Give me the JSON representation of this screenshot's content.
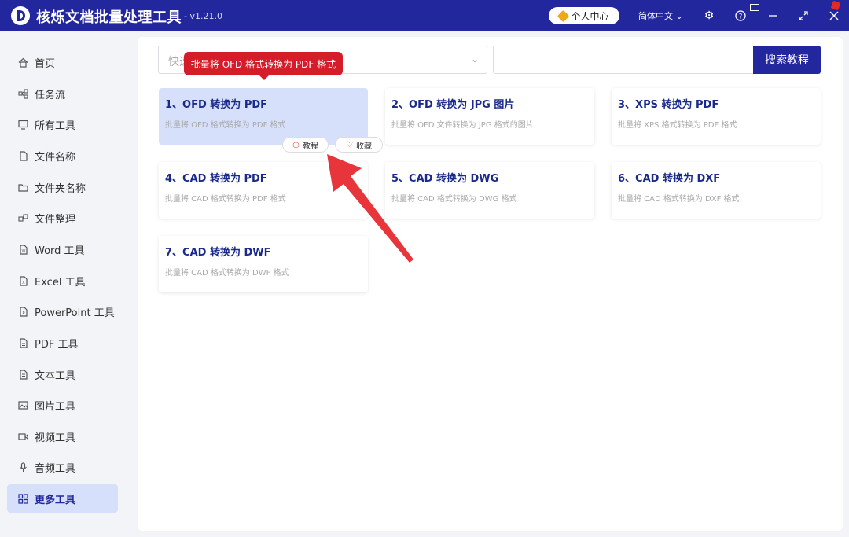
{
  "app": {
    "title": "核烁文档批量处理工具",
    "version": "- v1.21.0"
  },
  "titlebar": {
    "user_center": "个人中心",
    "language": "简体中文"
  },
  "sidebar": {
    "items": [
      {
        "label": "首页",
        "icon": "home-icon"
      },
      {
        "label": "任务流",
        "icon": "workflow-icon"
      },
      {
        "label": "所有工具",
        "icon": "monitor-icon"
      },
      {
        "label": "文件名称",
        "icon": "file-icon"
      },
      {
        "label": "文件夹名称",
        "icon": "folder-icon"
      },
      {
        "label": "文件整理",
        "icon": "organize-icon"
      },
      {
        "label": "Word 工具",
        "icon": "word-icon"
      },
      {
        "label": "Excel 工具",
        "icon": "excel-icon"
      },
      {
        "label": "PowerPoint 工具",
        "icon": "ppt-icon"
      },
      {
        "label": "PDF 工具",
        "icon": "pdf-icon"
      },
      {
        "label": "文本工具",
        "icon": "text-icon"
      },
      {
        "label": "图片工具",
        "icon": "image-icon"
      },
      {
        "label": "视频工具",
        "icon": "video-icon"
      },
      {
        "label": "音频工具",
        "icon": "mic-icon"
      },
      {
        "label": "更多工具",
        "icon": "grid-icon",
        "active": true
      }
    ]
  },
  "search": {
    "select_placeholder": "快速",
    "button": "搜索教程"
  },
  "tooltip": "批量将 OFD 格式转换为 PDF 格式",
  "card_actions": {
    "tutorial": "教程",
    "favorite": "收藏"
  },
  "cards": [
    {
      "title": "1、OFD 转换为 PDF",
      "desc": "批量将 OFD 格式转换为 PDF 格式"
    },
    {
      "title": "2、OFD 转换为 JPG 图片",
      "desc": "批量将 OFD 文件转换为 JPG 格式的图片"
    },
    {
      "title": "3、XPS 转换为 PDF",
      "desc": "批量将 XPS 格式转换为 PDF 格式"
    },
    {
      "title": "4、CAD 转换为 PDF",
      "desc": "批量将 CAD 格式转换为 PDF 格式"
    },
    {
      "title": "5、CAD 转换为 DWG",
      "desc": "批量将 CAD 格式转换为 DWG 格式"
    },
    {
      "title": "6、CAD 转换为 DXF",
      "desc": "批量将 CAD 格式转换为 DXF 格式"
    },
    {
      "title": "7、CAD 转换为 DWF",
      "desc": "批量将 CAD 格式转换为 DWF 格式"
    }
  ],
  "colors": {
    "brand": "#23279e",
    "active_bg": "#d6e0fb",
    "tooltip": "#d51d2a",
    "arrow": "#e8343b"
  }
}
